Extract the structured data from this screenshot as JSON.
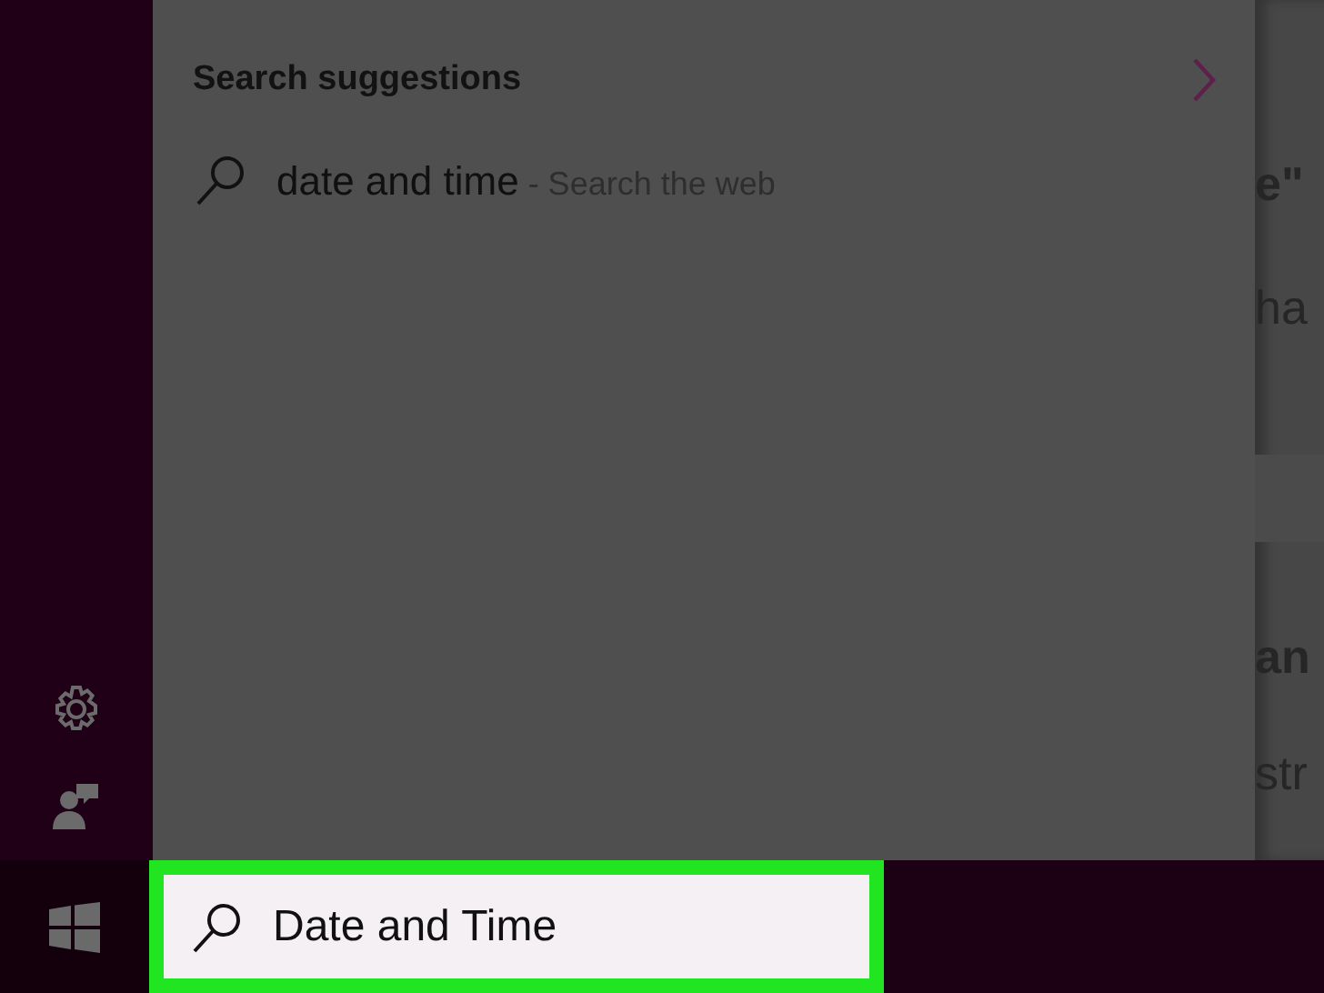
{
  "search_panel": {
    "heading": "Search suggestions",
    "suggestions": [
      {
        "query": "date and time",
        "hint": "- Search the web"
      }
    ]
  },
  "background_page": {
    "texts": [
      {
        "text": "e\"",
        "bold": true
      },
      {
        "text": "ha",
        "bold": false
      },
      {
        "text": "an",
        "bold": true
      },
      {
        "text": "str",
        "bold": false
      }
    ]
  },
  "taskbar": {
    "search": {
      "value": "Date and Time",
      "highlighted": true
    }
  }
}
